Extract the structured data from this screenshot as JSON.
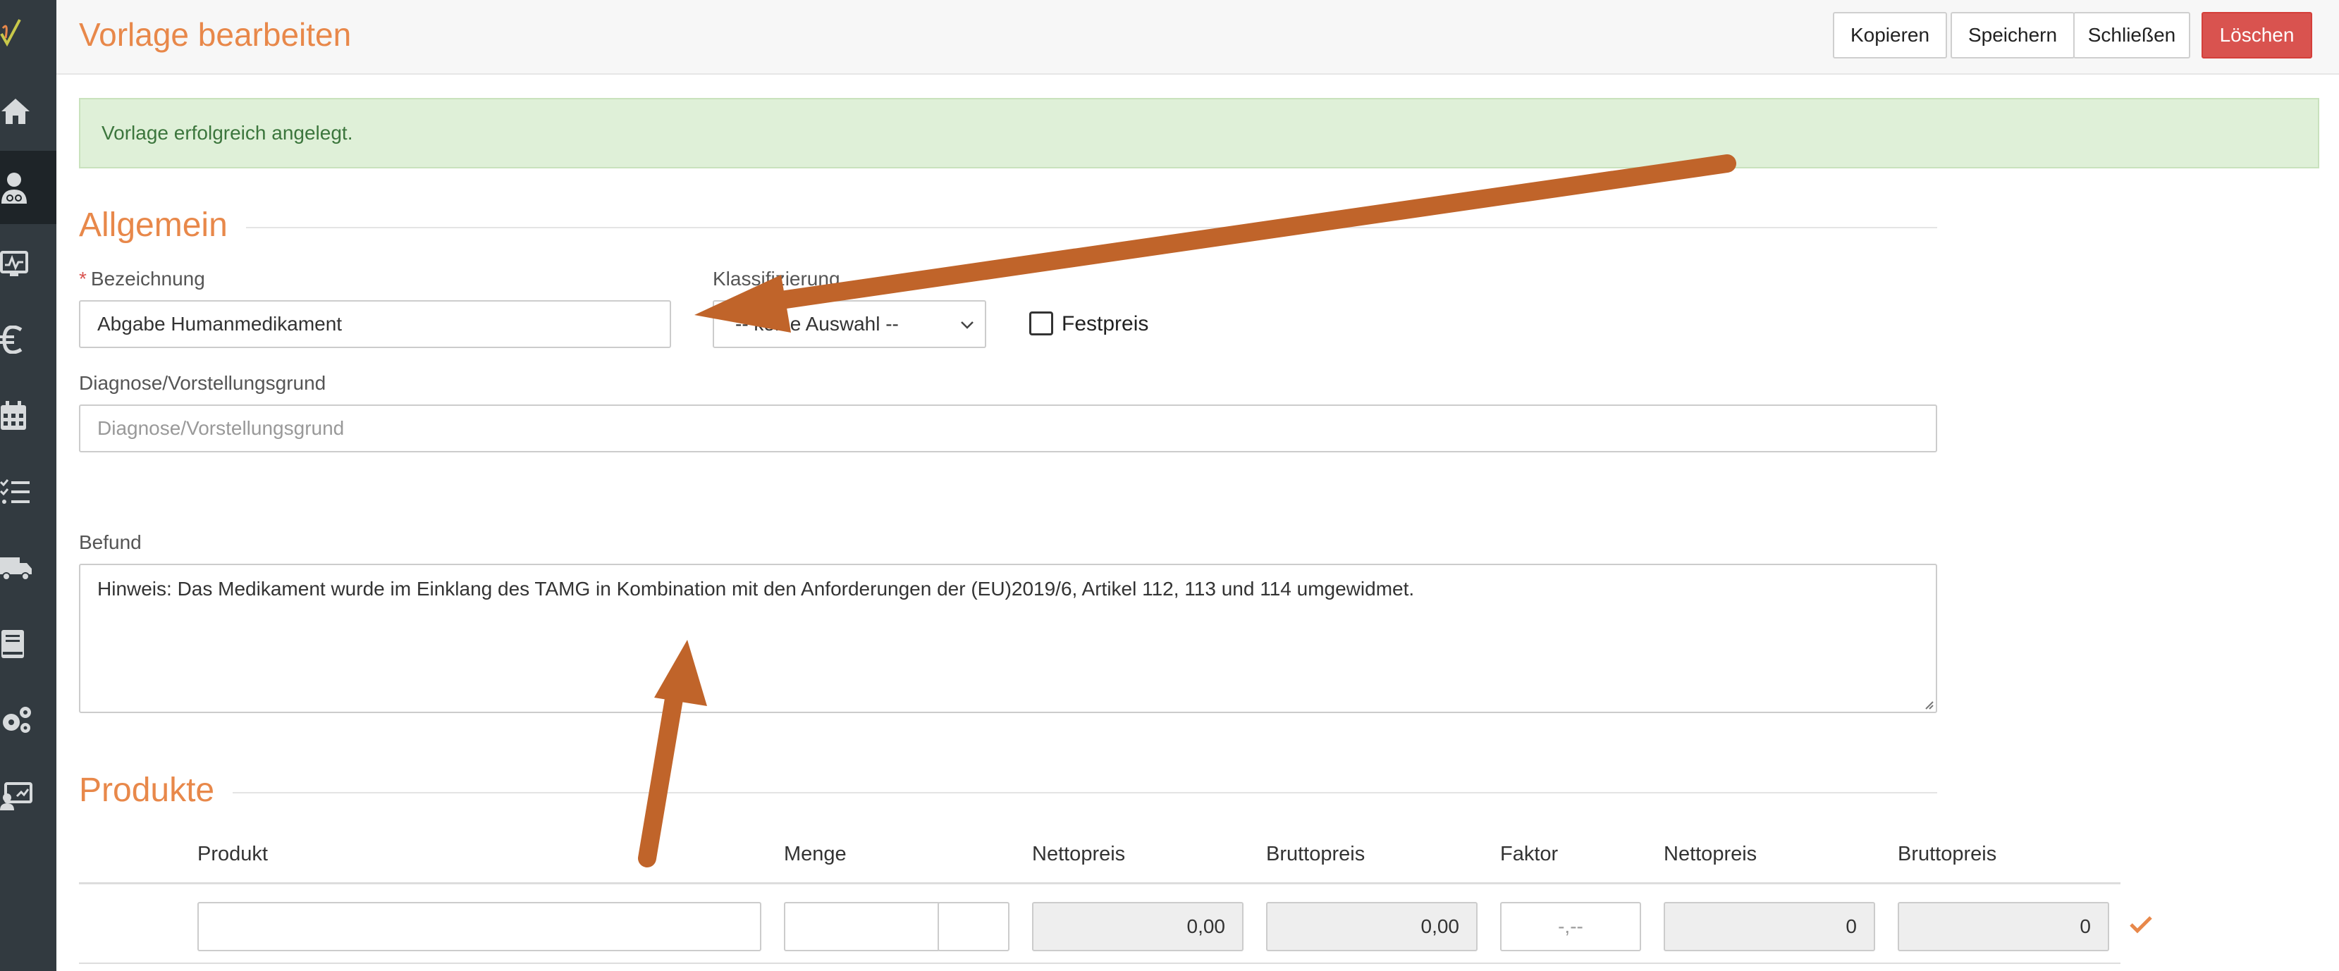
{
  "header": {
    "title": "Vorlage bearbeiten",
    "buttons": {
      "copy": "Kopieren",
      "save": "Speichern",
      "close": "Schließen",
      "delete": "Löschen"
    }
  },
  "alert": {
    "message": "Vorlage erfolgreich angelegt."
  },
  "sidebar": {
    "items": [
      {
        "icon": "home-icon"
      },
      {
        "icon": "user-medical-icon",
        "active": true
      },
      {
        "icon": "monitor-chart-icon"
      },
      {
        "icon": "euro-icon"
      },
      {
        "icon": "calendar-icon"
      },
      {
        "icon": "checklist-icon"
      },
      {
        "icon": "truck-icon"
      },
      {
        "icon": "book-icon"
      },
      {
        "icon": "cogs-icon"
      },
      {
        "icon": "screen-user-icon"
      }
    ]
  },
  "general": {
    "section_title": "Allgemein",
    "designation_label": "Bezeichnung",
    "designation_required_mark": "*",
    "designation_value": "Abgabe Humanmedikament",
    "classification_label": "Klassifizierung",
    "classification_value": "-- keine Auswahl --",
    "fixed_price_label": "Festpreis",
    "fixed_price_checked": false,
    "diagnosis_label": "Diagnose/Vorstellungsgrund",
    "diagnosis_placeholder": "Diagnose/Vorstellungsgrund",
    "finding_label": "Befund",
    "finding_value": "Hinweis: Das Medikament wurde im Einklang des TAMG in Kombination mit den Anforderungen der (EU)2019/6, Artikel 112, 113 und 114 umgewidmet."
  },
  "products": {
    "section_title": "Produkte",
    "columns": [
      "Produkt",
      "Menge",
      "Nettopreis",
      "Bruttopreis",
      "Faktor",
      "Nettopreis",
      "Bruttopreis"
    ],
    "row": {
      "product": "",
      "quantity": "",
      "unit": "",
      "net_price": "0,00",
      "gross_price": "0,00",
      "factor": "-,--",
      "net_total": "0",
      "gross_total": "0"
    }
  },
  "colors": {
    "accent": "#e8884a",
    "danger": "#d9534f",
    "success_bg": "#dff0d8",
    "success_text": "#3c763d",
    "sidebar_bg": "#323a40",
    "annotation_arrow": "#c0642a"
  }
}
